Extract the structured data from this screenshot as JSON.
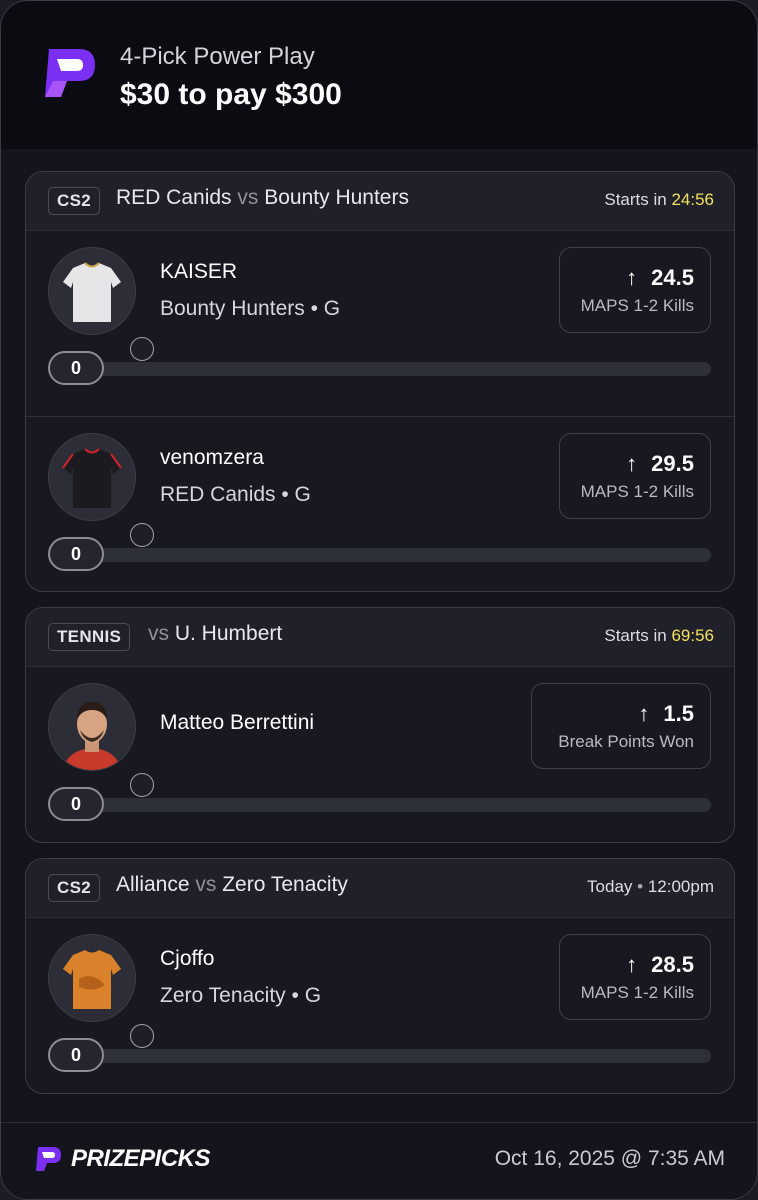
{
  "header": {
    "subtitle": "4-Pick Power Play",
    "title": "$30 to pay $300"
  },
  "games": [
    {
      "league": "CS2",
      "team_a": "RED Canids",
      "vs": "vs",
      "team_b": "Bounty Hunters",
      "start_prefix": "Starts in",
      "start_time": "24:56",
      "picks": [
        {
          "name": "KAISER",
          "team_pos": "Bounty Hunters • G",
          "line": "24.5",
          "stat": "MAPS 1-2 Kills",
          "progress": "0",
          "jersey": "white"
        },
        {
          "name": "venomzera",
          "team_pos": "RED Canids • G",
          "line": "29.5",
          "stat": "MAPS 1-2 Kills",
          "progress": "0",
          "jersey": "black-red"
        }
      ]
    },
    {
      "league": "TENNIS",
      "vs": "vs",
      "team_b": "U. Humbert",
      "start_prefix": "Starts in",
      "start_time": "69:56",
      "picks": [
        {
          "name": "Matteo Berrettini",
          "line": "1.5",
          "stat": "Break Points Won",
          "progress": "0",
          "jersey": "photo"
        }
      ]
    },
    {
      "league": "CS2",
      "team_a": "Alliance",
      "vs": "vs",
      "team_b": "Zero Tenacity",
      "start_day": "Today",
      "start_dot": "•",
      "start_time": "12:00pm",
      "picks": [
        {
          "name": "Cjoffo",
          "team_pos": "Zero Tenacity • G",
          "line": "28.5",
          "stat": "MAPS 1-2 Kills",
          "progress": "0",
          "jersey": "orange"
        }
      ]
    }
  ],
  "footer": {
    "brand": "PRIZEPICKS",
    "date": "Oct 16, 2025 @ 7:35 AM"
  },
  "colors": {
    "accent": "#8a2be2",
    "timer": "#f2e15a"
  }
}
